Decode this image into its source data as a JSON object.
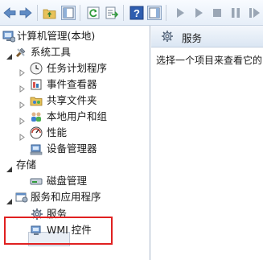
{
  "toolbar": {
    "buttons": [
      {
        "icon": "back-arrow-icon"
      },
      {
        "icon": "forward-arrow-icon"
      },
      {
        "icon": "up-folder-icon"
      },
      {
        "icon": "show-hide-tree-icon"
      },
      {
        "icon": "refresh-icon"
      },
      {
        "icon": "export-list-icon"
      },
      {
        "icon": "help-icon"
      },
      {
        "icon": "show-hide-action-pane-icon"
      },
      {
        "icon": "start-service-icon"
      },
      {
        "icon": "start-service-icon"
      },
      {
        "icon": "stop-service-icon"
      },
      {
        "icon": "pause-service-icon"
      },
      {
        "icon": "resume-service-icon"
      }
    ]
  },
  "tree": {
    "root": "计算机管理(本地)",
    "system_tools": "系统工具",
    "task_scheduler": "任务计划程序",
    "event_viewer": "事件查看器",
    "shared_folders": "共享文件夹",
    "local_users": "本地用户和组",
    "performance": "性能",
    "device_manager": "设备管理器",
    "storage": "存储",
    "disk_management": "磁盘管理",
    "services_apps": "服务和应用程序",
    "services": "服务",
    "wmi": "WMI 控件"
  },
  "right_pane": {
    "title": "服务",
    "prompt": "选择一个项目来查看它的"
  },
  "colors": {
    "highlight_border": "#e02020",
    "selected_bg": "#e9eef5"
  }
}
